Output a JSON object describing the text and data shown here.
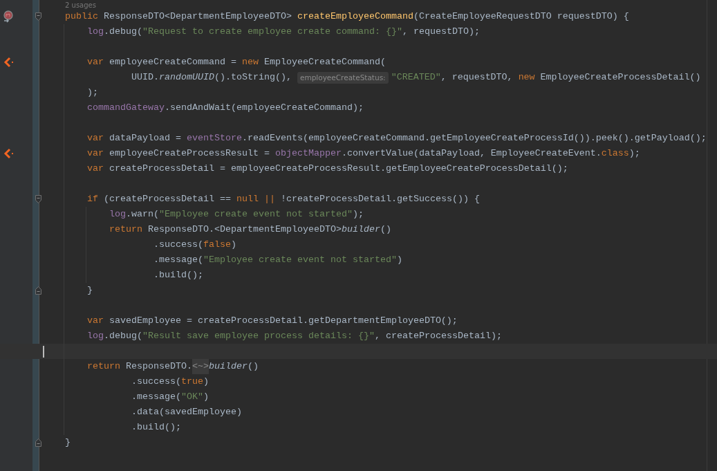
{
  "usages_hint": "2 usages",
  "lines": [
    {
      "current": false,
      "gutter": [
        {
          "kind": "override"
        },
        {
          "kind": "fold_start"
        }
      ],
      "tokens": [
        {
          "kind": "kw",
          "text": "    public"
        },
        {
          "kind": "plain",
          "text": " ResponseDTO<DepartmentEmployeeDTO> "
        },
        {
          "kind": "decl",
          "text": "createEmployeeCommand"
        },
        {
          "kind": "plain",
          "text": "(CreateEmployeeRequestDTO requestDTO) {"
        }
      ]
    },
    {
      "current": false,
      "tokens": [
        {
          "kind": "field",
          "text": "        log"
        },
        {
          "kind": "plain",
          "text": ".debug("
        },
        {
          "kind": "str",
          "text": "\"Request to create employee create command: {}\""
        },
        {
          "kind": "plain",
          "text": ", requestDTO);"
        }
      ]
    },
    {
      "current": false
    },
    {
      "current": false,
      "gutter": [
        {
          "kind": "axon"
        }
      ],
      "tokens": [
        {
          "kind": "kw",
          "text": "        var"
        },
        {
          "kind": "plain",
          "text": " employeeCreateCommand = "
        },
        {
          "kind": "kw",
          "text": "new"
        },
        {
          "kind": "plain",
          "text": " EmployeeCreateCommand("
        }
      ]
    },
    {
      "current": false,
      "tokens": [
        {
          "kind": "plain",
          "text": "                UUID."
        },
        {
          "kind": "static",
          "text": "randomUUID"
        },
        {
          "kind": "plain",
          "text": "().toString(), "
        },
        {
          "kind": "inlay",
          "text": "employeeCreateStatus:"
        },
        {
          "kind": "str",
          "text": "\"CREATED\""
        },
        {
          "kind": "plain",
          "text": ", requestDTO, "
        },
        {
          "kind": "kw",
          "text": "new"
        },
        {
          "kind": "plain",
          "text": " EmployeeCreateProcessDetail()"
        }
      ]
    },
    {
      "current": false,
      "tokens": [
        {
          "kind": "plain",
          "text": "        );"
        }
      ]
    },
    {
      "current": false,
      "tokens": [
        {
          "kind": "field",
          "text": "        commandGateway"
        },
        {
          "kind": "plain",
          "text": ".sendAndWait(employeeCreateCommand);"
        }
      ]
    },
    {
      "current": false
    },
    {
      "current": false,
      "tokens": [
        {
          "kind": "kw",
          "text": "        var"
        },
        {
          "kind": "plain",
          "text": " dataPayload = "
        },
        {
          "kind": "field",
          "text": "eventStore"
        },
        {
          "kind": "plain",
          "text": ".readEvents(employeeCreateCommand.getEmployeeCreateProcessId()).peek().getPayload();"
        }
      ]
    },
    {
      "current": false,
      "gutter": [
        {
          "kind": "axon"
        }
      ],
      "tokens": [
        {
          "kind": "kw",
          "text": "        var"
        },
        {
          "kind": "plain",
          "text": " employeeCreateProcessResult = "
        },
        {
          "kind": "field",
          "text": "objectMapper"
        },
        {
          "kind": "plain",
          "text": ".convertValue(dataPayload, EmployeeCreateEvent."
        },
        {
          "kind": "kw",
          "text": "class"
        },
        {
          "kind": "plain",
          "text": ");"
        }
      ]
    },
    {
      "current": false,
      "tokens": [
        {
          "kind": "kw",
          "text": "        var"
        },
        {
          "kind": "plain",
          "text": " createProcessDetail = employeeCreateProcessResult.getEmployeeCreateProcessDetail();"
        }
      ]
    },
    {
      "current": false
    },
    {
      "current": false,
      "gutter": [
        {
          "kind": "fold_start"
        }
      ],
      "tokens": [
        {
          "kind": "kw",
          "text": "        if"
        },
        {
          "kind": "plain",
          "text": " (createProcessDetail == "
        },
        {
          "kind": "kw",
          "text": "null"
        },
        {
          "kind": "kw",
          "text": " ||"
        },
        {
          "kind": "plain",
          "text": " !createProcessDetail.getSuccess()) {"
        }
      ]
    },
    {
      "current": false,
      "tokens": [
        {
          "kind": "field",
          "text": "            log"
        },
        {
          "kind": "plain",
          "text": ".warn("
        },
        {
          "kind": "str",
          "text": "\"Employee create event not started\""
        },
        {
          "kind": "plain",
          "text": ");"
        }
      ]
    },
    {
      "current": false,
      "tokens": [
        {
          "kind": "kw",
          "text": "            return"
        },
        {
          "kind": "plain",
          "text": " ResponseDTO.<DepartmentEmployeeDTO>"
        },
        {
          "kind": "static",
          "text": "builder"
        },
        {
          "kind": "plain",
          "text": "()"
        }
      ]
    },
    {
      "current": false,
      "tokens": [
        {
          "kind": "plain",
          "text": "                    .success("
        },
        {
          "kind": "kw",
          "text": "false"
        },
        {
          "kind": "plain",
          "text": ")"
        }
      ]
    },
    {
      "current": false,
      "tokens": [
        {
          "kind": "plain",
          "text": "                    .message("
        },
        {
          "kind": "str",
          "text": "\"Employee create event not started\""
        },
        {
          "kind": "plain",
          "text": ")"
        }
      ]
    },
    {
      "current": false,
      "tokens": [
        {
          "kind": "plain",
          "text": "                    .build();"
        }
      ]
    },
    {
      "current": false,
      "gutter": [
        {
          "kind": "fold_end"
        }
      ],
      "tokens": [
        {
          "kind": "plain",
          "text": "        }"
        }
      ]
    },
    {
      "current": false
    },
    {
      "current": false,
      "tokens": [
        {
          "kind": "kw",
          "text": "        var"
        },
        {
          "kind": "plain",
          "text": " savedEmployee = createProcessDetail.getDepartmentEmployeeDTO();"
        }
      ]
    },
    {
      "current": false,
      "tokens": [
        {
          "kind": "field",
          "text": "        log"
        },
        {
          "kind": "plain",
          "text": ".debug("
        },
        {
          "kind": "str",
          "text": "\"Result save employee process details: {}\""
        },
        {
          "kind": "plain",
          "text": ", createProcessDetail);"
        }
      ]
    },
    {
      "current": true
    },
    {
      "current": false,
      "tokens": [
        {
          "kind": "kw",
          "text": "        return"
        },
        {
          "kind": "plain",
          "text": " ResponseDTO."
        },
        {
          "kind": "fold",
          "text": "<~>"
        },
        {
          "kind": "static",
          "text": "builder"
        },
        {
          "kind": "plain",
          "text": "()"
        }
      ]
    },
    {
      "current": false,
      "tokens": [
        {
          "kind": "plain",
          "text": "                .success("
        },
        {
          "kind": "kw",
          "text": "true"
        },
        {
          "kind": "plain",
          "text": ")"
        }
      ]
    },
    {
      "current": false,
      "tokens": [
        {
          "kind": "plain",
          "text": "                .message("
        },
        {
          "kind": "str",
          "text": "\"OK\""
        },
        {
          "kind": "plain",
          "text": ")"
        }
      ]
    },
    {
      "current": false,
      "tokens": [
        {
          "kind": "plain",
          "text": "                .data(savedEmployee)"
        }
      ]
    },
    {
      "current": false,
      "tokens": [
        {
          "kind": "plain",
          "text": "                .build();"
        }
      ]
    },
    {
      "current": false,
      "gutter": [
        {
          "kind": "fold_end"
        }
      ],
      "tokens": [
        {
          "kind": "plain",
          "text": "    }"
        }
      ]
    }
  ]
}
